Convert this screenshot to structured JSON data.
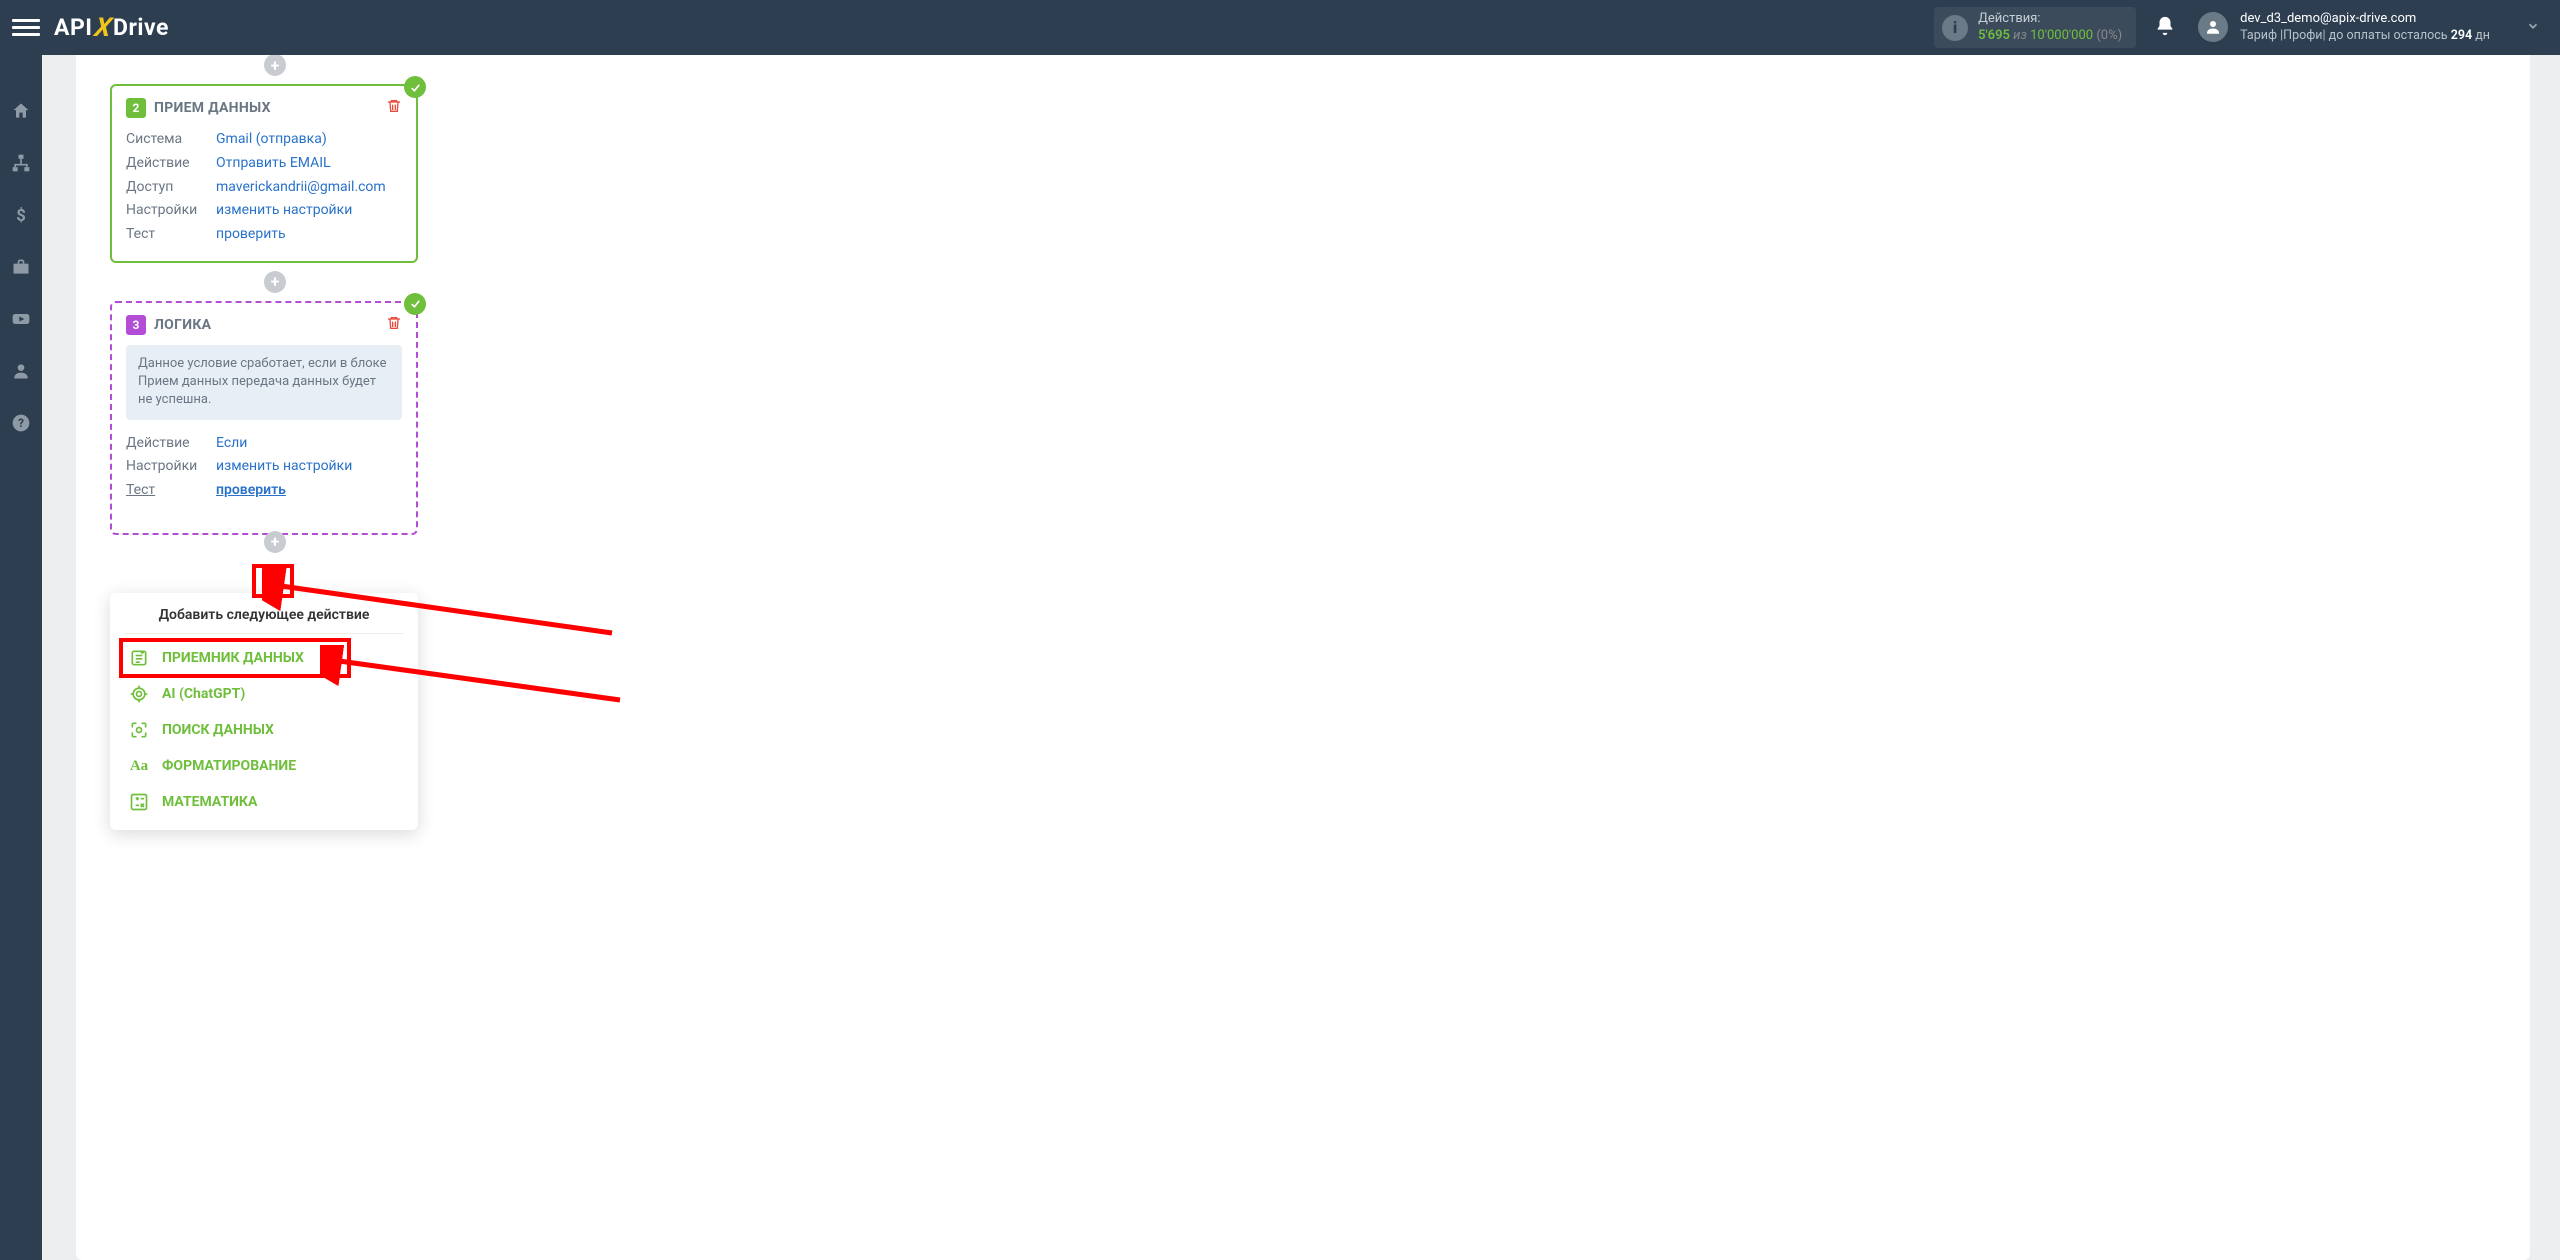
{
  "header": {
    "logo_api": "API",
    "logo_x": "X",
    "logo_drive": "Drive",
    "actions_label": "Действия:",
    "actions_count": "5'695",
    "actions_of": "из",
    "actions_limit": "10'000'000",
    "actions_pct": "(0%)",
    "user_email": "dev_d3_demo@apix-drive.com",
    "tariff_prefix": "Тариф |Профи| до оплаты осталось ",
    "tariff_days": "294",
    "tariff_suffix": " дн"
  },
  "card2": {
    "num": "2",
    "title": "ПРИЕМ ДАННЫХ",
    "rows": {
      "system_label": "Система",
      "system_value": "Gmail (отправка)",
      "action_label": "Действие",
      "action_value": "Отправить EMAIL",
      "access_label": "Доступ",
      "access_value": "maverickandrii@gmail.com",
      "settings_label": "Настройки",
      "settings_value": "изменить настройки",
      "test_label": "Тест",
      "test_value": "проверить"
    }
  },
  "card3": {
    "num": "3",
    "title": "ЛОГИКА",
    "info": "Данное условие сработает, если в блоке Прием данных передача данных будет не успешна.",
    "rows": {
      "action_label": "Действие",
      "action_value": "Если",
      "settings_label": "Настройки",
      "settings_value": "изменить настройки",
      "test_label": "Тест",
      "test_value": "проверить"
    }
  },
  "popup": {
    "title": "Добавить следующее действие",
    "items": [
      "ПРИЕМНИК ДАННЫХ",
      "AI (ChatGPT)",
      "ПОИСК ДАННЫХ",
      "ФОРМАТИРОВАНИЕ",
      "МАТЕМАТИКА"
    ]
  }
}
